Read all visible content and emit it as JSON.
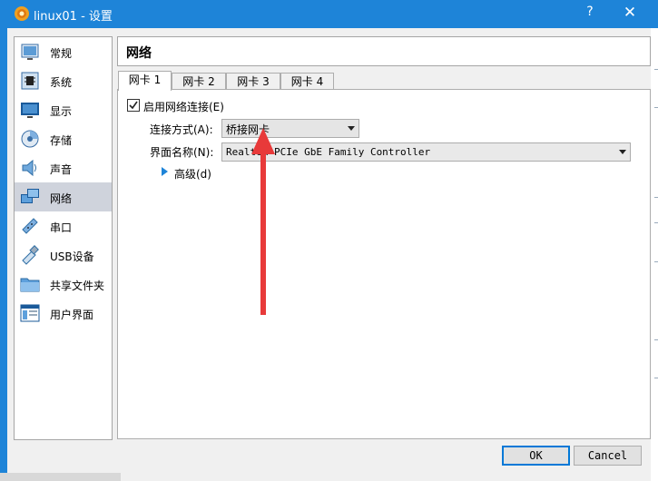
{
  "window": {
    "title": "linux01 - 设置",
    "help_glyph": "?",
    "close_glyph": "✕",
    "title_bar_color": "#1e84d8"
  },
  "page": {
    "title": "网络"
  },
  "sidebar": {
    "selected": "网络",
    "items": [
      {
        "label": "常规",
        "icon": "general-icon"
      },
      {
        "label": "系统",
        "icon": "system-chip-icon"
      },
      {
        "label": "显示",
        "icon": "display-monitor-icon"
      },
      {
        "label": "存储",
        "icon": "storage-disk-icon"
      },
      {
        "label": "声音",
        "icon": "speaker-icon"
      },
      {
        "label": "网络",
        "icon": "network-icon"
      },
      {
        "label": "串口",
        "icon": "serial-port-icon"
      },
      {
        "label": "USB设备",
        "icon": "usb-icon"
      },
      {
        "label": "共享文件夹",
        "icon": "shared-folder-icon"
      },
      {
        "label": "用户界面",
        "icon": "user-interface-icon"
      }
    ]
  },
  "tabs": [
    {
      "label": "网卡 1",
      "active": true
    },
    {
      "label": "网卡 2",
      "active": false
    },
    {
      "label": "网卡 3",
      "active": false
    },
    {
      "label": "网卡 4",
      "active": false
    }
  ],
  "adapter": {
    "enable_label": "启用网络连接(E)",
    "enabled": true,
    "attached_to_label": "连接方式(A):",
    "attached_to_value": "桥接网卡",
    "interface_label": "界面名称(N):",
    "interface_value": "Realtek PCIe GbE Family Controller",
    "advanced_label": "高级(d)"
  },
  "buttons": {
    "ok": "OK",
    "cancel": "Cancel"
  },
  "annotation": {
    "arrow_color": "#e83a3a",
    "icon": "red-arrow-annotation"
  }
}
